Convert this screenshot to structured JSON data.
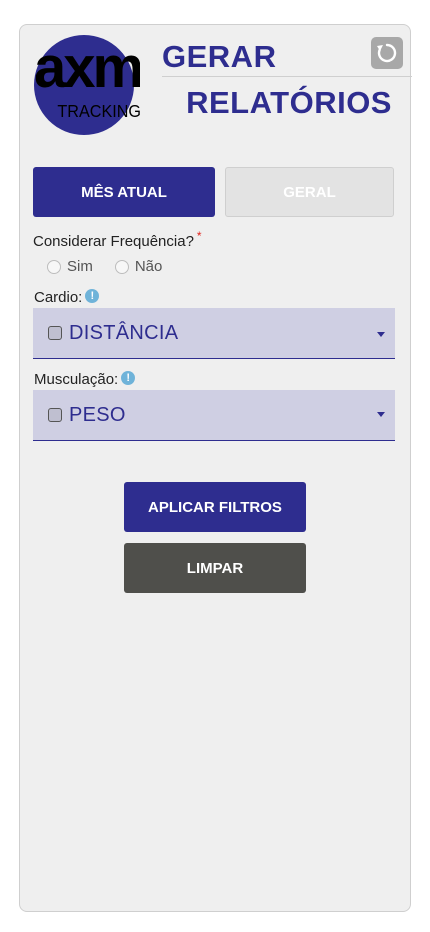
{
  "header": {
    "logo_text": "axm",
    "logo_subtext": "TRACKING",
    "title_line1": "GERAR",
    "title_line2": "RELATÓRIOS",
    "reset_icon": "refresh-icon"
  },
  "tabs": {
    "current_month": "MÊS ATUAL",
    "general": "GERAL"
  },
  "frequency": {
    "label": "Considerar Frequência?",
    "required_mark": "*",
    "options": [
      "Sim",
      "Não"
    ]
  },
  "cardio": {
    "label": "Cardio:",
    "info_icon": "info-icon",
    "selected": "DISTÂNCIA"
  },
  "strength": {
    "label": "Musculação:",
    "info_icon": "info-icon",
    "selected": "PESO"
  },
  "actions": {
    "apply": "APLICAR FILTROS",
    "clear": "LIMPAR"
  },
  "colors": {
    "primary": "#2e2d8f",
    "inactive_tab": "#e3e3e3",
    "select_bg": "#cfcfe3",
    "clear_button": "#4f4f4b",
    "reset_icon_bg": "#a8a8a8",
    "info": "#6fb3d9",
    "required": "#e0241c"
  }
}
